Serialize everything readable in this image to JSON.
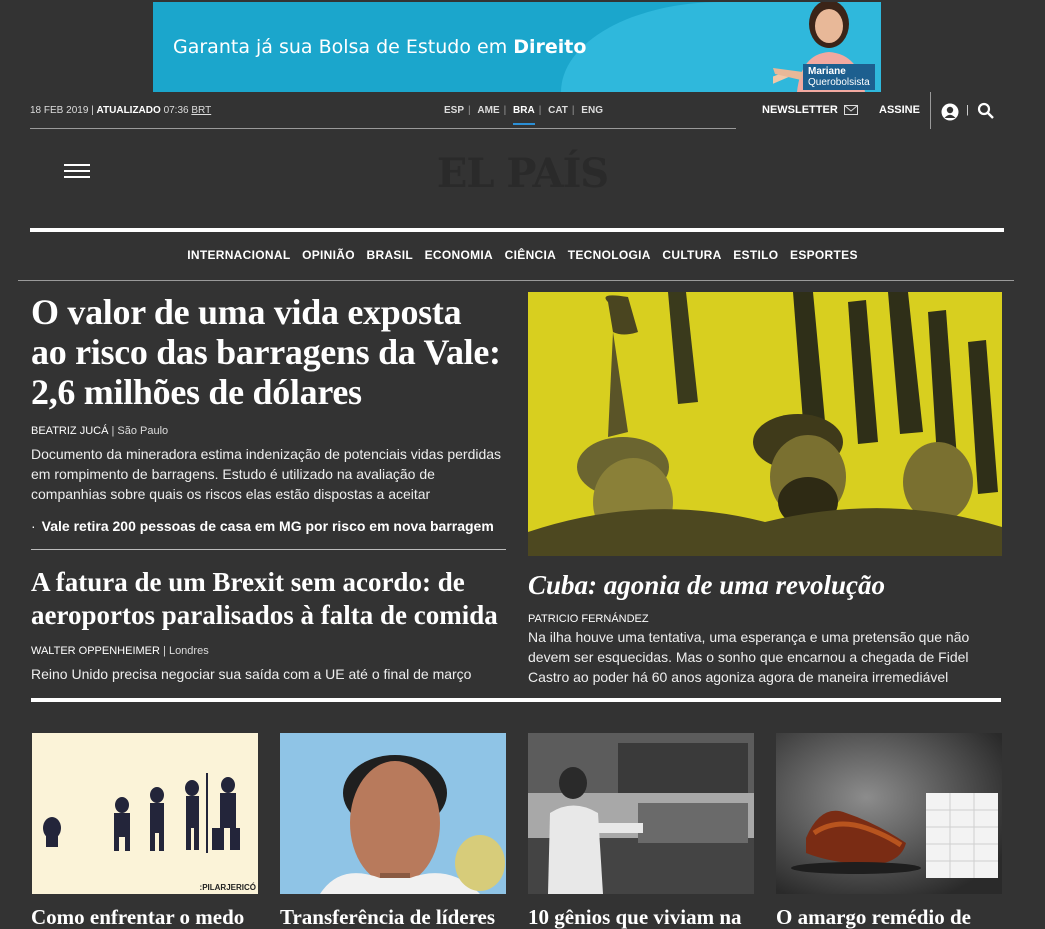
{
  "ad": {
    "text_prefix": "Garanta já sua Bolsa de Estudo em ",
    "text_bold": "Direito",
    "caption_name": "Mariane",
    "caption_sub": "Querobolsista"
  },
  "topbar": {
    "date": "18 FEB 2019 |",
    "updated_label": "ATUALIZADO",
    "updated_time": "07:36",
    "updated_tz": "BRT",
    "editions": [
      "ESP",
      "AME",
      "BRA",
      "CAT",
      "ENG"
    ],
    "active_edition": "BRA",
    "newsletter": "NEWSLETTER",
    "subscribe": "ASSINE",
    "pipe": "|"
  },
  "logo": "EL PAÍS",
  "nav": [
    "INTERNACIONAL",
    "OPINIÃO",
    "BRASIL",
    "ECONOMIA",
    "CIÊNCIA",
    "TECNOLOGIA",
    "CULTURA",
    "ESTILO",
    "ESPORTES"
  ],
  "lead": {
    "title": "O valor de uma vida exposta ao risco das barragens da Vale: 2,6 milhões de dólares",
    "author": "BEATRIZ JUCÁ",
    "location": "| São Paulo",
    "summary": "Documento da mineradora estima indenização de potenciais vidas perdidas em rompimento de barragens. Estudo é utilizado na avaliação de companhias sobre quais os riscos elas estão dispostas a aceitar",
    "related": "Vale retira 200 pessoas de casa em MG por risco em nova barragem"
  },
  "second": {
    "title": "A fatura de um Brexit sem acordo: de aeroportos paralisados à falta de comida",
    "author": "WALTER OPPENHEIMER",
    "location": "| Londres",
    "summary": "Reino Unido precisa negociar sua saída com a UE até o final de março"
  },
  "feature": {
    "title": "Cuba: agonia de uma revolução",
    "author": "PATRICIO FERNÁNDEZ",
    "summary": "Na ilha houve uma tentativa, uma esperança e uma pretensão que não devem ser esquecidas. Mas o sonho que encarnou a chegada de Fidel Castro ao poder há 60 anos agoniza agora de maneira irremediável"
  },
  "thumbs": [
    {
      "title": "Como enfrentar o medo",
      "credit": ":PILARJERICÓ"
    },
    {
      "title": "Transferência de líderes"
    },
    {
      "title": "10 gênios que viviam na"
    },
    {
      "title": "O amargo remédio de"
    }
  ],
  "colors": {
    "background": "#333333",
    "ad_blue": "#1ba6cc",
    "photo_yellow": "#d8cf1f",
    "active_edition_underline": "#2b8fd6"
  }
}
